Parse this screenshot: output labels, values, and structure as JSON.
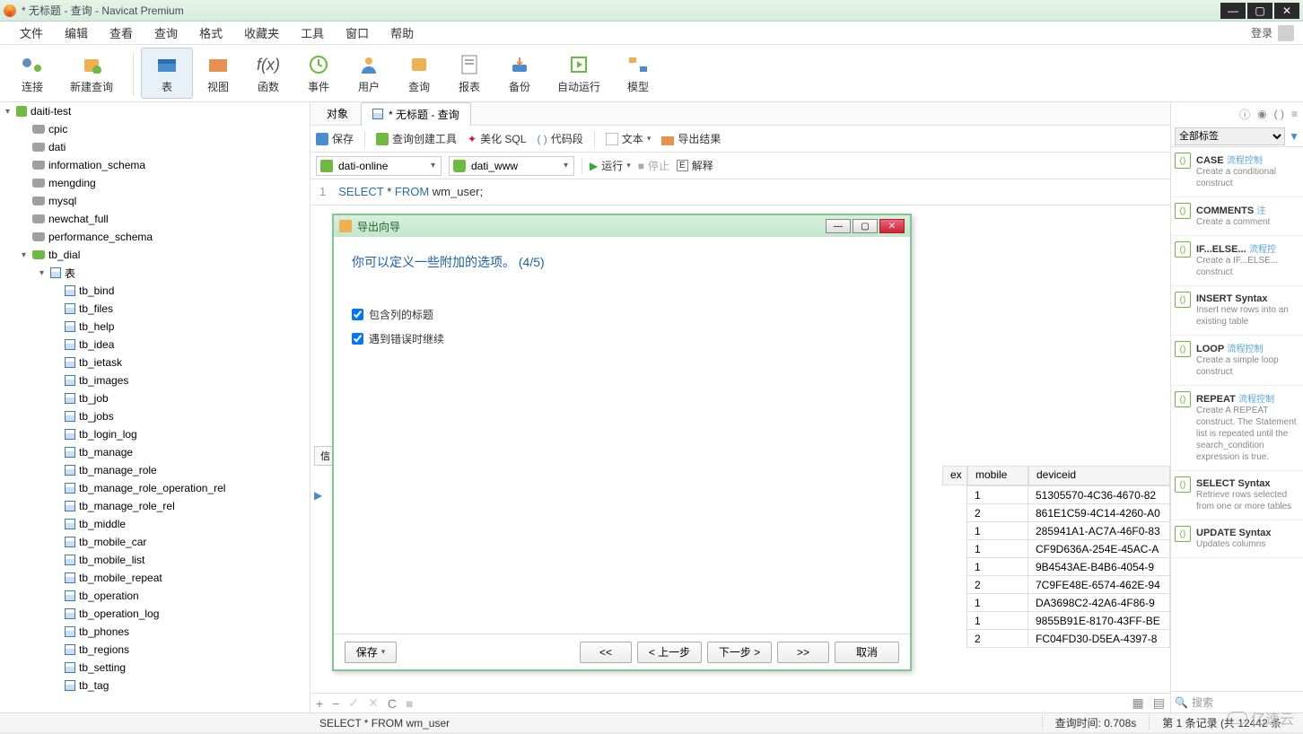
{
  "window": {
    "title": "* 无标题 - 查询 - Navicat Premium"
  },
  "winbtns": {
    "min": "—",
    "max": "▢",
    "close": "✕"
  },
  "menu": {
    "file": "文件",
    "edit": "编辑",
    "view": "查看",
    "query": "查询",
    "format": "格式",
    "favorites": "收藏夹",
    "tools": "工具",
    "window": "窗口",
    "help": "帮助",
    "login": "登录"
  },
  "toolbar": {
    "connect": "连接",
    "newquery": "新建查询",
    "table": "表",
    "view": "视图",
    "function": "函数",
    "event": "事件",
    "user": "用户",
    "query": "查询",
    "report": "报表",
    "backup": "备份",
    "autorun": "自动运行",
    "model": "模型"
  },
  "tree": {
    "conn": "daiti-test",
    "dbs": [
      "cpic",
      "dati",
      "information_schema",
      "mengding",
      "mysql",
      "newchat_full",
      "performance_schema"
    ],
    "open_db": "tb_dial",
    "tables_label": "表",
    "tables": [
      "tb_bind",
      "tb_files",
      "tb_help",
      "tb_idea",
      "tb_ietask",
      "tb_images",
      "tb_job",
      "tb_jobs",
      "tb_login_log",
      "tb_manage",
      "tb_manage_role",
      "tb_manage_role_operation_rel",
      "tb_manage_role_rel",
      "tb_middle",
      "tb_mobile_car",
      "tb_mobile_list",
      "tb_mobile_repeat",
      "tb_operation",
      "tb_operation_log",
      "tb_phones",
      "tb_regions",
      "tb_setting",
      "tb_tag"
    ]
  },
  "tabs": {
    "objects": "对象",
    "query": "* 无标题 - 查询"
  },
  "qtoolbar": {
    "save": "保存",
    "builder": "查询创建工具",
    "beautify": "美化 SQL",
    "snippet": "代码段",
    "text": "文本",
    "export": "导出结果"
  },
  "connrow": {
    "conn": "dati-online",
    "db": "dati_www",
    "run": "运行",
    "stop": "停止",
    "explain": "解释"
  },
  "sql": {
    "line": "1",
    "text_kw1": "SELECT",
    "text_star": " * ",
    "text_kw2": "FROM",
    "text_tbl": " wm_user;"
  },
  "grid": {
    "cols": [
      "ex",
      "mobile",
      "deviceid"
    ],
    "rows": [
      {
        "mobile": "1",
        "deviceid": "51305570-4C36-4670-82"
      },
      {
        "mobile": "2",
        "deviceid": "861E1C59-4C14-4260-A0"
      },
      {
        "mobile": "1",
        "deviceid": "285941A1-AC7A-46F0-83"
      },
      {
        "mobile": "1",
        "deviceid": "CF9D636A-254E-45AC-A"
      },
      {
        "mobile": "1",
        "deviceid": "9B4543AE-B4B6-4054-9"
      },
      {
        "mobile": "2",
        "deviceid": "7C9FE48E-6574-462E-94"
      },
      {
        "mobile": "1",
        "deviceid": "DA3698C2-42A6-4F86-9"
      },
      {
        "mobile": "1",
        "deviceid": "9855B91E-8170-43FF-BE"
      },
      {
        "mobile": "2",
        "deviceid": "FC04FD30-D5EA-4397-8"
      }
    ],
    "info_tab": "信"
  },
  "modal": {
    "title": "导出向导",
    "heading": "你可以定义一些附加的选项。 (4/5)",
    "chk1": "包含列的标题",
    "chk2": "遇到错误时继续",
    "save": "保存",
    "first": "<<",
    "prev": "< 上一步",
    "next": "下一步 >",
    "last": ">>",
    "cancel": "取消"
  },
  "right": {
    "filter": "全部标签",
    "search": "搜索",
    "snippets": [
      {
        "title": "CASE",
        "tag": "流程控制",
        "desc": "Create a conditional construct"
      },
      {
        "title": "COMMENTS",
        "tag": "注",
        "desc": "Create a comment"
      },
      {
        "title": "IF...ELSE...",
        "tag": "流程控",
        "desc": "Create a IF...ELSE... construct"
      },
      {
        "title": "INSERT Syntax",
        "tag": "",
        "desc": "Insert new rows into an existing table"
      },
      {
        "title": "LOOP",
        "tag": "流程控制",
        "desc": "Create a simple loop construct"
      },
      {
        "title": "REPEAT",
        "tag": "流程控制",
        "desc": "Create A REPEAT construct. The Statement list is repeated until the search_condition expression is true."
      },
      {
        "title": "SELECT Syntax",
        "tag": "",
        "desc": "Retrieve rows selected from one or more tables"
      },
      {
        "title": "UPDATE Syntax",
        "tag": "",
        "desc": "Updates columns"
      }
    ]
  },
  "status": {
    "sql": "SELECT * FROM wm_user",
    "time": "查询时间: 0.708s",
    "rec": "第 1 条记录 (共 12442 条"
  },
  "watermark": "亿速云"
}
